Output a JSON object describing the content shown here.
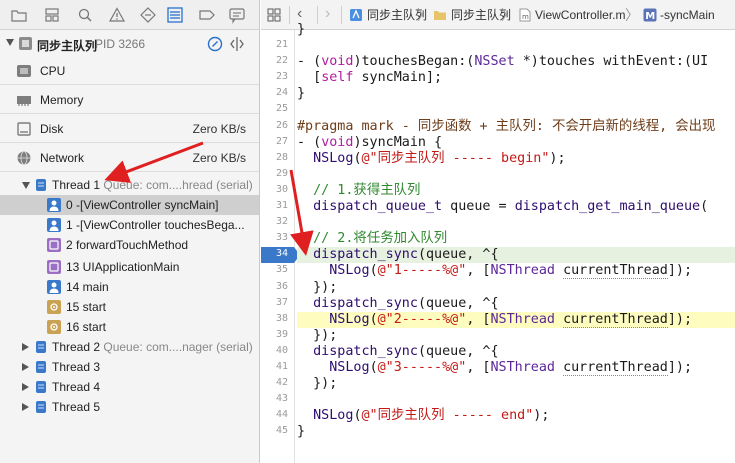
{
  "navigator": {
    "process": {
      "name": "同步主队列",
      "pid": "PID 3266"
    },
    "gauges": [
      {
        "label": "CPU",
        "value": ""
      },
      {
        "label": "Memory",
        "value": ""
      },
      {
        "label": "Disk",
        "value": "Zero KB/s"
      },
      {
        "label": "Network",
        "value": "Zero KB/s"
      }
    ],
    "thread1": {
      "name": "Thread 1",
      "queue": "Queue: com....hread (serial)"
    },
    "frames": [
      "0 -[ViewController syncMain]",
      "1 -[ViewController touchesBega...",
      "2 forwardTouchMethod",
      "13 UIApplicationMain",
      "14 main",
      "15 start",
      "16 start"
    ],
    "threads": [
      {
        "name": "Thread 2",
        "queue": "Queue: com....nager (serial)"
      },
      {
        "name": "Thread 3",
        "queue": ""
      },
      {
        "name": "Thread 4",
        "queue": ""
      },
      {
        "name": "Thread 5",
        "queue": ""
      }
    ]
  },
  "jumpbar": {
    "items": [
      "同步主队列",
      "同步主队列",
      "ViewController.m",
      "-syncMain"
    ],
    "separator": "〉"
  },
  "editor": {
    "partial_top": "}",
    "lines": [
      {
        "no": "21",
        "text": ""
      },
      {
        "no": "22",
        "text": "- (void)touchesBegan:(NSSet *)touches withEvent:(UI"
      },
      {
        "no": "23",
        "text": "  [self syncMain];"
      },
      {
        "no": "24",
        "text": "}"
      },
      {
        "no": "25",
        "text": ""
      },
      {
        "no": "26",
        "text": "#pragma mark - 同步函数 + 主队列: 不会开启新的线程, 会出现"
      },
      {
        "no": "27",
        "text": "- (void)syncMain {"
      },
      {
        "no": "28",
        "text": "  NSLog(@\"同步主队列 ----- begin\");"
      },
      {
        "no": "29",
        "text": ""
      },
      {
        "no": "30",
        "text": "  // 1.获得主队列"
      },
      {
        "no": "31",
        "text": "  dispatch_queue_t queue = dispatch_get_main_queue("
      },
      {
        "no": "32",
        "text": ""
      },
      {
        "no": "33",
        "text": "  // 2.将任务加入队列"
      },
      {
        "no": "34",
        "text": "  dispatch_sync(queue, ^{"
      },
      {
        "no": "35",
        "text": "    NSLog(@\"1-----%@\", [NSThread currentThread]);"
      },
      {
        "no": "36",
        "text": "  });"
      },
      {
        "no": "37",
        "text": "  dispatch_sync(queue, ^{"
      },
      {
        "no": "38",
        "text": "    NSLog(@\"2-----%@\", [NSThread currentThread]);"
      },
      {
        "no": "39",
        "text": "  });"
      },
      {
        "no": "40",
        "text": "  dispatch_sync(queue, ^{"
      },
      {
        "no": "41",
        "text": "    NSLog(@\"3-----%@\", [NSThread currentThread]);"
      },
      {
        "no": "42",
        "text": "  });"
      },
      {
        "no": "43",
        "text": ""
      },
      {
        "no": "44",
        "text": "  NSLog(@\"同步主队列 ----- end\");"
      },
      {
        "no": "45",
        "text": "}"
      }
    ],
    "current_line": "34",
    "highlight_line": "38"
  },
  "colors": {
    "accent": "#2a6ed0",
    "arrow": "#e02020",
    "current_line_bg": "#e6f1e0",
    "warning_line_bg": "#fefcbf"
  }
}
